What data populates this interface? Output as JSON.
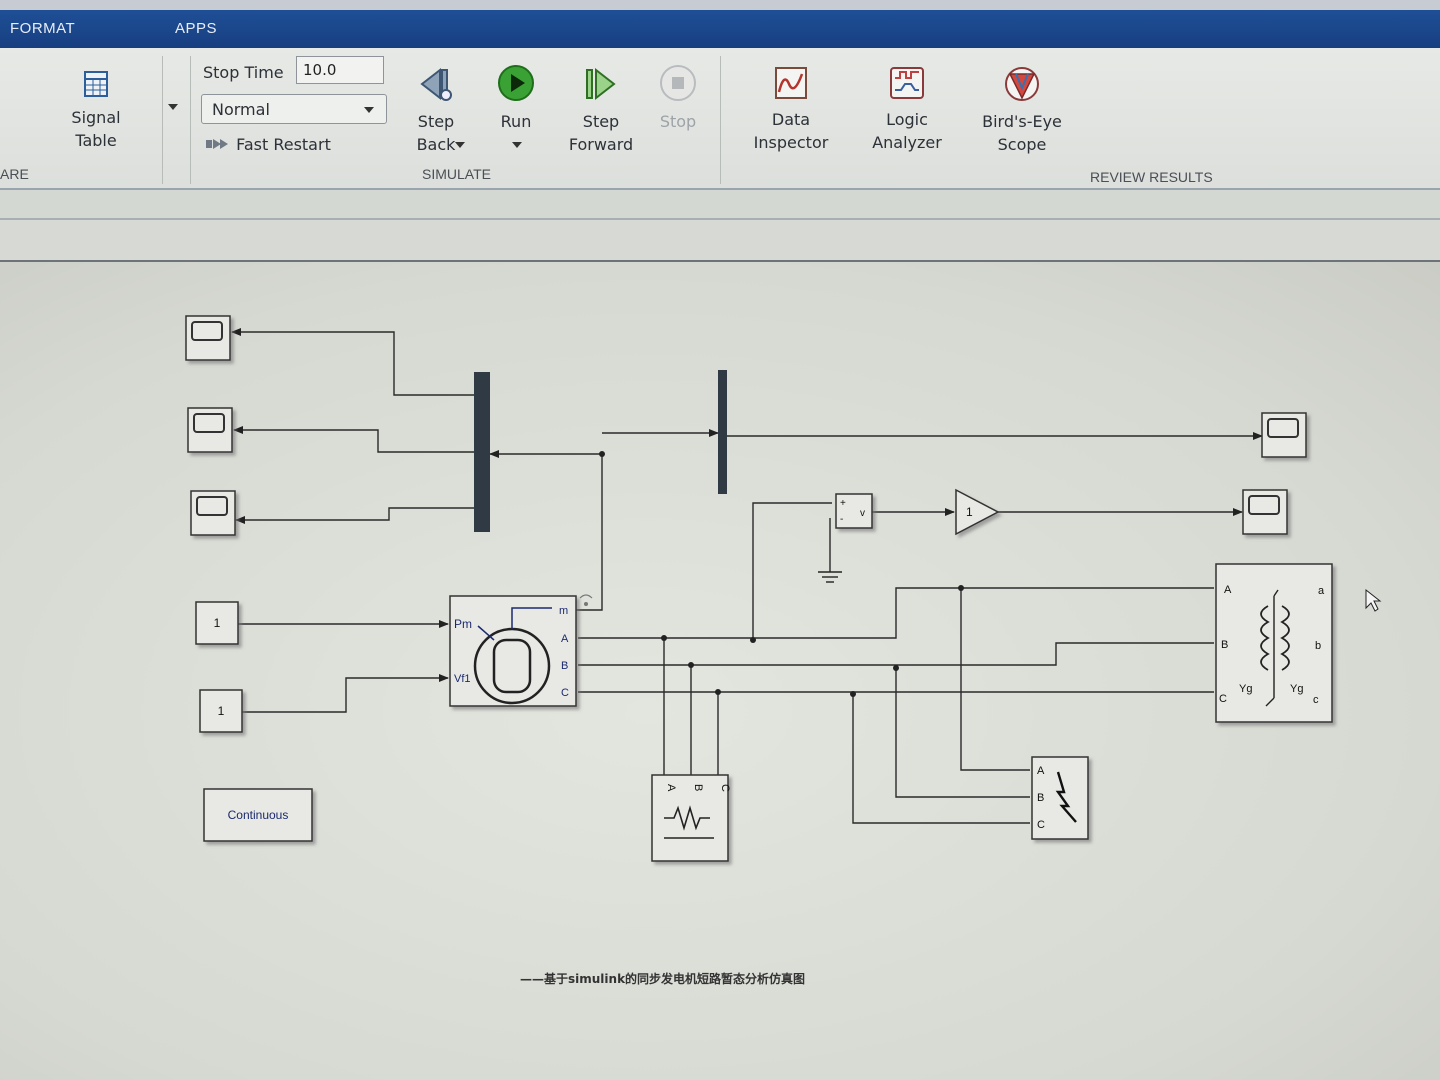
{
  "tabs": [
    {
      "label": "FORMAT"
    },
    {
      "label": "APPS"
    }
  ],
  "ribbon": {
    "prepare_fragment": "ARE",
    "signal_table": "Signal\nTable",
    "stop_time_label": "Stop Time",
    "stop_time_value": "10.0",
    "sim_mode": "Normal",
    "fast_restart": "Fast Restart",
    "step_back": "Step\nBack",
    "run": "Run",
    "step_forward": "Step\nForward",
    "stop": "Stop",
    "simulate_label": "SIMULATE",
    "data_inspector": "Data\nInspector",
    "logic_analyzer": "Logic\nAnalyzer",
    "birds_eye": "Bird's-Eye\nScope",
    "review_label": "REVIEW RESULTS"
  },
  "diagram": {
    "constant1": "1",
    "constant2": "1",
    "gain": "1",
    "powergui": "Continuous",
    "machine_ports": {
      "pm": "Pm",
      "vf": "Vf1",
      "m": "m",
      "a": "A",
      "b": "B",
      "c": "C"
    },
    "voltage_meas": {
      "plus": "+",
      "minus": "-",
      "v": "v"
    },
    "load_ports": {
      "a": "A",
      "b": "B",
      "c": "C"
    },
    "fault_ports": {
      "a": "A",
      "b": "B",
      "c": "C"
    },
    "transformer": {
      "a_in": "A",
      "b_in": "B",
      "c_in": "C",
      "a_out": "a",
      "b_out": "b",
      "c_out": "c",
      "wind1": "Yg",
      "wind2": "Yg"
    },
    "caption": "——基于simulink的同步发电机短路暂态分析仿真图"
  },
  "colors": {
    "tabbar": "#1f4f97",
    "canvas": "#e0e2dc",
    "bus": "#2f3a45",
    "run_green": "#3aa234"
  }
}
